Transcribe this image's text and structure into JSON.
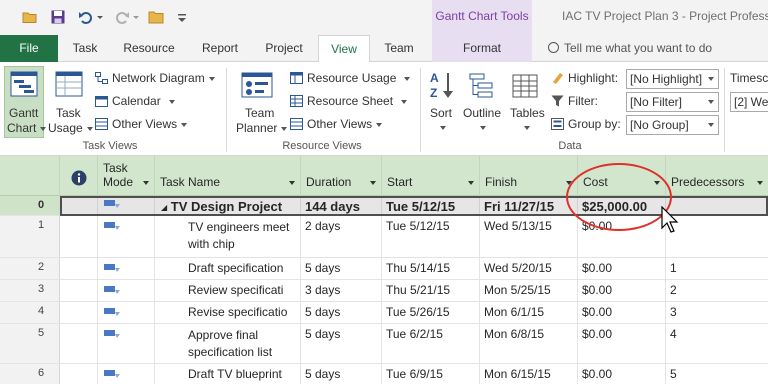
{
  "titlebar": {
    "contextual_tab_group": "Gantt Chart Tools",
    "document_title": "IAC TV Project Plan 3  -  Project Profess"
  },
  "tabs": [
    {
      "label": "File"
    },
    {
      "label": "Task"
    },
    {
      "label": "Resource"
    },
    {
      "label": "Report"
    },
    {
      "label": "Project"
    },
    {
      "label": "View",
      "selected": true
    },
    {
      "label": "Team"
    },
    {
      "label": "Format"
    }
  ],
  "tell_me": "Tell me what you want to do",
  "ribbon": {
    "task_views": {
      "group_label": "Task Views",
      "gantt_chart": [
        "Gantt",
        "Chart"
      ],
      "task_usage": [
        "Task",
        "Usage"
      ],
      "network_diagram": "Network Diagram",
      "calendar": "Calendar",
      "other_views": "Other Views"
    },
    "resource_views": {
      "group_label": "Resource Views",
      "team_planner": [
        "Team",
        "Planner"
      ],
      "resource_usage": "Resource Usage",
      "resource_sheet": "Resource Sheet",
      "other_views": "Other Views"
    },
    "data": {
      "group_label": "Data",
      "sort": "Sort",
      "outline": "Outline",
      "tables": "Tables",
      "highlight_label": "Highlight:",
      "highlight_value": "[No Highlight]",
      "filter_label": "Filter:",
      "filter_value": "[No Filter]",
      "group_by_label": "Group by:",
      "group_by_value": "[No Group]"
    },
    "zoom": {
      "timescale_label": "Timesc",
      "timescale_value": "[2] We"
    }
  },
  "grid": {
    "columns": [
      "Task Mode",
      "Task Name",
      "Duration",
      "Start",
      "Finish",
      "Cost",
      "Predecessors"
    ],
    "task_mode_header": [
      "Task",
      "Mode"
    ],
    "rows": [
      {
        "id": "0",
        "name": "TV Design Project",
        "duration": "144 days",
        "start": "Tue 5/12/15",
        "finish": "Fri 11/27/15",
        "cost": "$25,000.00",
        "pred": "",
        "summary": true
      },
      {
        "id": "1",
        "name": "TV engineers meet with chip",
        "duration": "2 days",
        "start": "Tue 5/12/15",
        "finish": "Wed 5/13/15",
        "cost": "$0.00",
        "pred": ""
      },
      {
        "id": "2",
        "name": "Draft specification",
        "duration": "5 days",
        "start": "Thu 5/14/15",
        "finish": "Wed 5/20/15",
        "cost": "$0.00",
        "pred": "1"
      },
      {
        "id": "3",
        "name": "Review specificati",
        "duration": "3 days",
        "start": "Thu 5/21/15",
        "finish": "Mon 5/25/15",
        "cost": "$0.00",
        "pred": "2"
      },
      {
        "id": "4",
        "name": "Revise specificatio",
        "duration": "5 days",
        "start": "Tue 5/26/15",
        "finish": "Mon 6/1/15",
        "cost": "$0.00",
        "pred": "3"
      },
      {
        "id": "5",
        "name": "Approve final specification list",
        "duration": "5 days",
        "start": "Tue 6/2/15",
        "finish": "Mon 6/8/15",
        "cost": "$0.00",
        "pred": "4"
      },
      {
        "id": "6",
        "name": "Draft TV blueprint",
        "duration": "5 days",
        "start": "Tue 6/9/15",
        "finish": "Mon 6/15/15",
        "cost": "$0.00",
        "pred": "5"
      }
    ]
  },
  "colors": {
    "file_tab": "#217346",
    "header_green": "#d2e6cd",
    "contextual_purple": "#e7dff1",
    "annotation_red": "#e0302a"
  }
}
